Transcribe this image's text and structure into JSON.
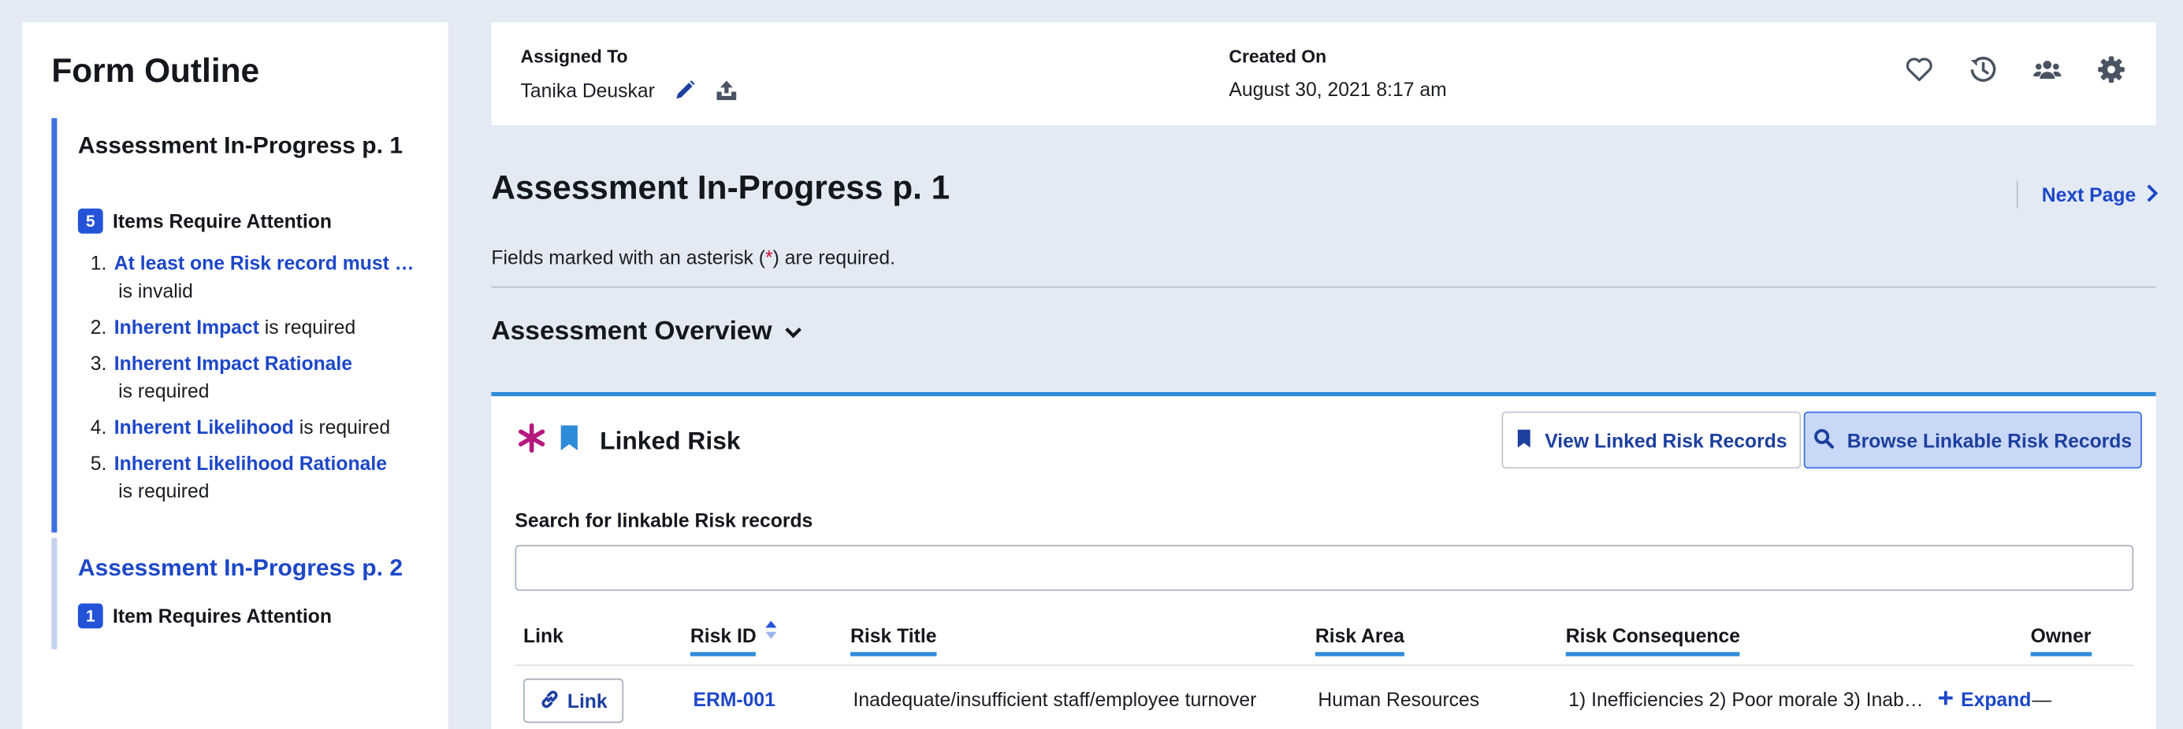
{
  "sidebar": {
    "title": "Form Outline",
    "sections": [
      {
        "title": "Assessment In-Progress p. 1",
        "count": "5",
        "attention": "Items Require Attention",
        "issues": [
          {
            "num": "1.",
            "link": "At least one Risk record must be li…",
            "text": "is invalid"
          },
          {
            "num": "2.",
            "link": "Inherent Impact",
            "text": "is required"
          },
          {
            "num": "3.",
            "link": "Inherent Impact Rationale",
            "text": "is required"
          },
          {
            "num": "4.",
            "link": "Inherent Likelihood",
            "text": "is required"
          },
          {
            "num": "5.",
            "link": "Inherent Likelihood Rationale",
            "text": "is required"
          }
        ]
      },
      {
        "title": "Assessment In-Progress p. 2",
        "count": "1",
        "attention": "Item Requires Attention"
      }
    ]
  },
  "header": {
    "assigned_label": "Assigned To",
    "assigned_value": "Tanika Deuskar",
    "created_label": "Created On",
    "created_value": "August 30, 2021 8:17 am",
    "icons": [
      "heart-icon",
      "history-icon",
      "users-icon",
      "gear-icon"
    ]
  },
  "page": {
    "title": "Assessment In-Progress p. 1",
    "next_label": "Next Page",
    "required_note_prefix": "Fields marked with an asterisk (",
    "required_note_asterisk": "*",
    "required_note_suffix": ") are required.",
    "section_title": "Assessment Overview"
  },
  "linked_risk": {
    "title": "Linked Risk",
    "view_button": "View Linked Risk Records",
    "browse_button": "Browse Linkable Risk Records",
    "search_label": "Search for linkable Risk records",
    "search_value": "",
    "columns": [
      "Link",
      "Risk ID",
      "Risk Title",
      "Risk Area",
      "Risk Consequence",
      "Owner"
    ],
    "rows": [
      {
        "link_label": "Link",
        "risk_id": "ERM-001",
        "title": "Inadequate/insufficient staff/employee turnover",
        "area": "Human Resources",
        "consequence": "1) Inefficiencies 2) Poor morale 3) Inab…",
        "expand_label": "Expand",
        "owner": "—"
      }
    ]
  },
  "colors": {
    "accent_blue": "#1d47c8",
    "badge_blue": "#2453d8",
    "required_asterisk": "#c8102e",
    "bookmark_blue": "#2e8bd9",
    "star_magenta": "#b5197d"
  }
}
